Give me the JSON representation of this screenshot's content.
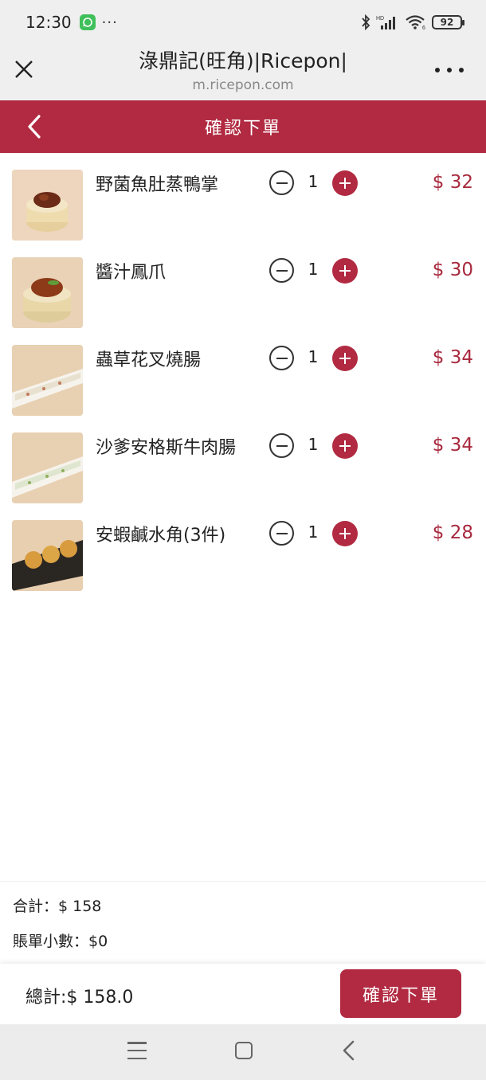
{
  "status_bar": {
    "time": "12:30",
    "notification_icons": [
      "whatsapp-icon",
      "more-dots"
    ],
    "more": "···",
    "hd_label": "HD",
    "signal_sub": "6",
    "battery": "92"
  },
  "browser": {
    "title": "淥鼎記(旺角)|Ricepon|",
    "url": "m.ricepon.com"
  },
  "app_header": {
    "title": "確認下單"
  },
  "items": [
    {
      "name": "野菌魚肚蒸鴨掌",
      "qty": "1",
      "price": "$ 32",
      "image": "dim-sum-bowl"
    },
    {
      "name": "醬汁鳳爪",
      "qty": "1",
      "price": "$ 30",
      "image": "chicken-feet-bowl"
    },
    {
      "name": "蟲草花叉燒腸",
      "qty": "1",
      "price": "$ 34",
      "image": "rice-roll-plate"
    },
    {
      "name": "沙爹安格斯牛肉腸",
      "qty": "1",
      "price": "$ 34",
      "image": "rice-roll-plate"
    },
    {
      "name": "安蝦鹹水角(3件)",
      "qty": "1",
      "price": "$ 28",
      "image": "dumpling-plate"
    }
  ],
  "summary": {
    "subtotal": "合計：$ 158",
    "rounding": "賬單小數：$0"
  },
  "footer": {
    "total": "總計:$ 158.0",
    "confirm_label": "確認下單"
  },
  "colors": {
    "accent": "#b12a41",
    "price": "#a82a3e"
  }
}
